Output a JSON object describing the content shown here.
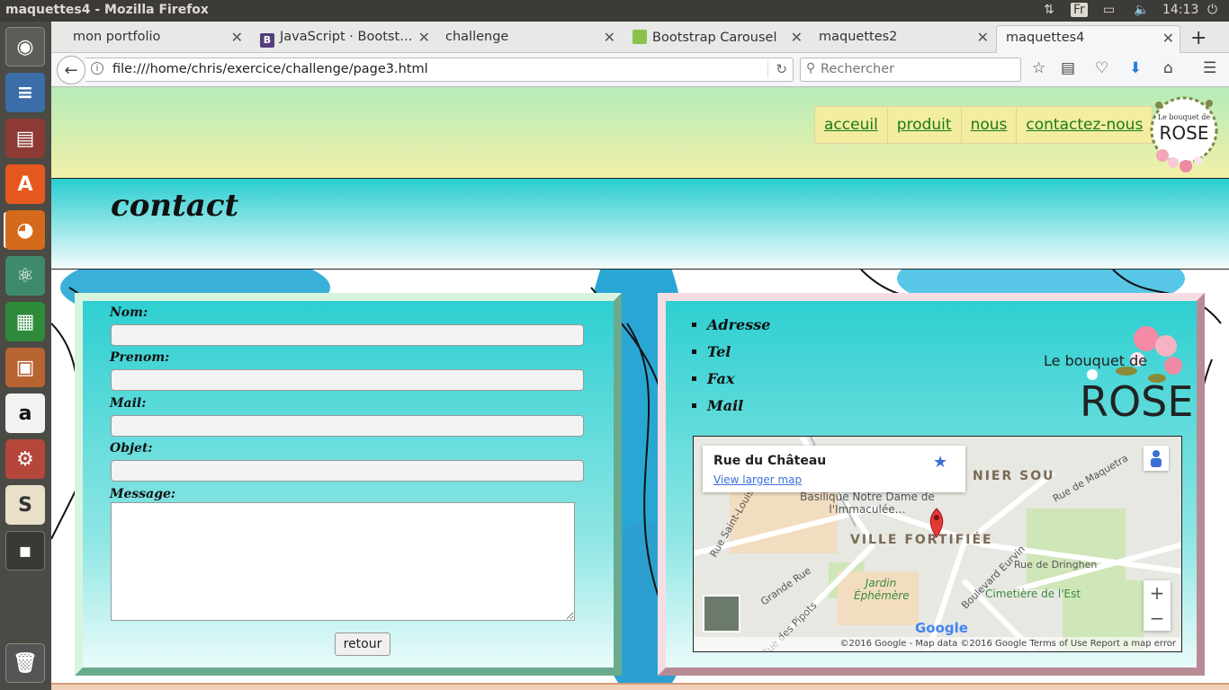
{
  "system": {
    "window_title": "maquettes4 - Mozilla Firefox",
    "keyboard_layout": "Fr",
    "clock": "14:13"
  },
  "launcher": {
    "items": [
      "Dash",
      "LibreOffice Writer",
      "Files",
      "Ubuntu Software",
      "Firefox",
      "Atom",
      "LibreOffice Calc",
      "LibreOffice Impress",
      "Amazon",
      "System Settings",
      "Slack",
      "Workspaces",
      "Trash"
    ]
  },
  "browser": {
    "tabs": [
      {
        "label": "mon portfolio",
        "active": false
      },
      {
        "label": "JavaScript · Bootst…",
        "active": false,
        "fav": "B"
      },
      {
        "label": "challenge",
        "active": false
      },
      {
        "label": "Bootstrap Carousel",
        "active": false
      },
      {
        "label": "maquettes2",
        "active": false
      },
      {
        "label": "maquettes4",
        "active": true
      }
    ],
    "url": "file:///home/chris/exercice/challenge/page3.html",
    "search_placeholder": "Rechercher"
  },
  "site": {
    "nav": [
      "acceuil",
      "produit",
      "nous",
      "contactez-nous"
    ],
    "logo_text": {
      "line1": "Le bouquet de",
      "line2": "ROSE"
    },
    "page_title": "contact",
    "form": {
      "fields": [
        {
          "label": "Nom:",
          "value": ""
        },
        {
          "label": "Prenom:",
          "value": ""
        },
        {
          "label": "Mail:",
          "value": ""
        },
        {
          "label": "Objet:",
          "value": ""
        }
      ],
      "message_label": "Message:",
      "submit_label": "retour"
    },
    "info_items": [
      "Adresse",
      "Tel",
      "Fax",
      "Mail"
    ],
    "map": {
      "place_title": "Rue du Château",
      "view_link": "View larger map",
      "labels": {
        "district": "VILLE FORTIFIÉE",
        "district2": "NIER SOU",
        "basilica": "Basilique Notre Dame de l'Immaculée…",
        "garden": "Jardin Éphémère",
        "cemetery": "Cimetière de l'Est",
        "road1": "Rue de Dringhen",
        "road2": "Rue de Maquetra",
        "road3": "Grande Rue",
        "road4": "Rue des Pipots",
        "road5": "Boulevard Eurvin",
        "road6": "Rue Saint-Louis"
      },
      "footer": "©2016 Google - Map data ©2016 Google   Terms of Use   Report a map error",
      "google": "Google"
    }
  }
}
